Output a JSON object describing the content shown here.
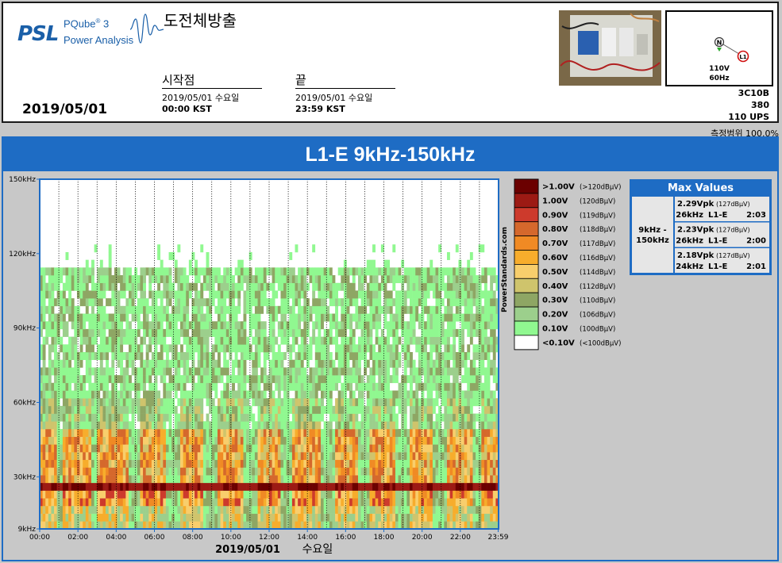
{
  "header": {
    "logo": "PSL",
    "product": "PQube",
    "product_sup": "®",
    "product_num": "3",
    "tagline": "Power Analysis",
    "site_name": "도전체방출",
    "start_label": "시작점",
    "start_date": "2019/05/01 수요일",
    "start_time": "00:00 KST",
    "end_label": "끝",
    "end_date": "2019/05/01 수요일",
    "end_time": "23:59 KST",
    "report_date": "2019/05/01",
    "diagram_n": "N",
    "diagram_l1": "L1",
    "diagram_voltage": "110V",
    "diagram_freq": "60Hz",
    "meta": [
      "3C10B",
      "380",
      "110 UPS"
    ],
    "range_text": "측정범위 100.0%"
  },
  "chart_data": {
    "type": "heatmap",
    "title": "L1-E 9kHz-150kHz",
    "x_ticks": [
      "00:00",
      "02:00",
      "04:00",
      "06:00",
      "08:00",
      "10:00",
      "12:00",
      "14:00",
      "16:00",
      "18:00",
      "20:00",
      "22:00",
      "23:59"
    ],
    "y_ticks": [
      "150kHz",
      "120kHz",
      "90kHz",
      "60kHz",
      "30kHz",
      "9kHz"
    ],
    "x_date": "2019/05/01",
    "x_weekday": "수요일",
    "watermark": "PowerStandards.com",
    "legend": [
      {
        "v": ">1.00V",
        "db": "(>120dBµV)",
        "color": "#6b0000"
      },
      {
        "v": "1.00V",
        "db": "(120dBµV)",
        "color": "#9c1a14"
      },
      {
        "v": "0.90V",
        "db": "(119dBµV)",
        "color": "#cd3a2c"
      },
      {
        "v": "0.80V",
        "db": "(118dBµV)",
        "color": "#d5682c"
      },
      {
        "v": "0.70V",
        "db": "(117dBµV)",
        "color": "#f08a24"
      },
      {
        "v": "0.60V",
        "db": "(116dBµV)",
        "color": "#f7ad2c"
      },
      {
        "v": "0.50V",
        "db": "(114dBµV)",
        "color": "#f8ce6c"
      },
      {
        "v": "0.40V",
        "db": "(112dBµV)",
        "color": "#cfc46c"
      },
      {
        "v": "0.30V",
        "db": "(110dBµV)",
        "color": "#8ea664"
      },
      {
        "v": "0.20V",
        "db": "(106dBµV)",
        "color": "#9ccf8c"
      },
      {
        "v": "0.10V",
        "db": "(100dBµV)",
        "color": "#90f890"
      },
      {
        "v": "<0.10V",
        "db": "(<100dBµV)",
        "color": "#ffffff"
      }
    ],
    "max_values": {
      "title": "Max Values",
      "band": "9kHz - 150kHz",
      "rows": [
        {
          "value": "2.29Vpk",
          "db": "(127dBµV)",
          "freq": "26kHz",
          "channel": "L1-E",
          "time": "2:03"
        },
        {
          "value": "2.23Vpk",
          "db": "(127dBµV)",
          "freq": "26kHz",
          "channel": "L1-E",
          "time": "2:00"
        },
        {
          "value": "2.18Vpk",
          "db": "(127dBµV)",
          "freq": "24kHz",
          "channel": "L1-E",
          "time": "2:01"
        }
      ]
    },
    "peak_band_khz": [
      22,
      26
    ],
    "active_periods_hours": [
      [
        0,
        0.8
      ],
      [
        1.2,
        2.6
      ],
      [
        3,
        4.5
      ],
      [
        5.2,
        6.6
      ],
      [
        7.2,
        8.5
      ],
      [
        9.2,
        10.6
      ],
      [
        11.3,
        12.6
      ],
      [
        13.2,
        14.6
      ],
      [
        15.3,
        16.6
      ],
      [
        17.2,
        18.5
      ],
      [
        19.3,
        20.5
      ],
      [
        21.2,
        22.6
      ],
      [
        23,
        23.9
      ]
    ]
  }
}
